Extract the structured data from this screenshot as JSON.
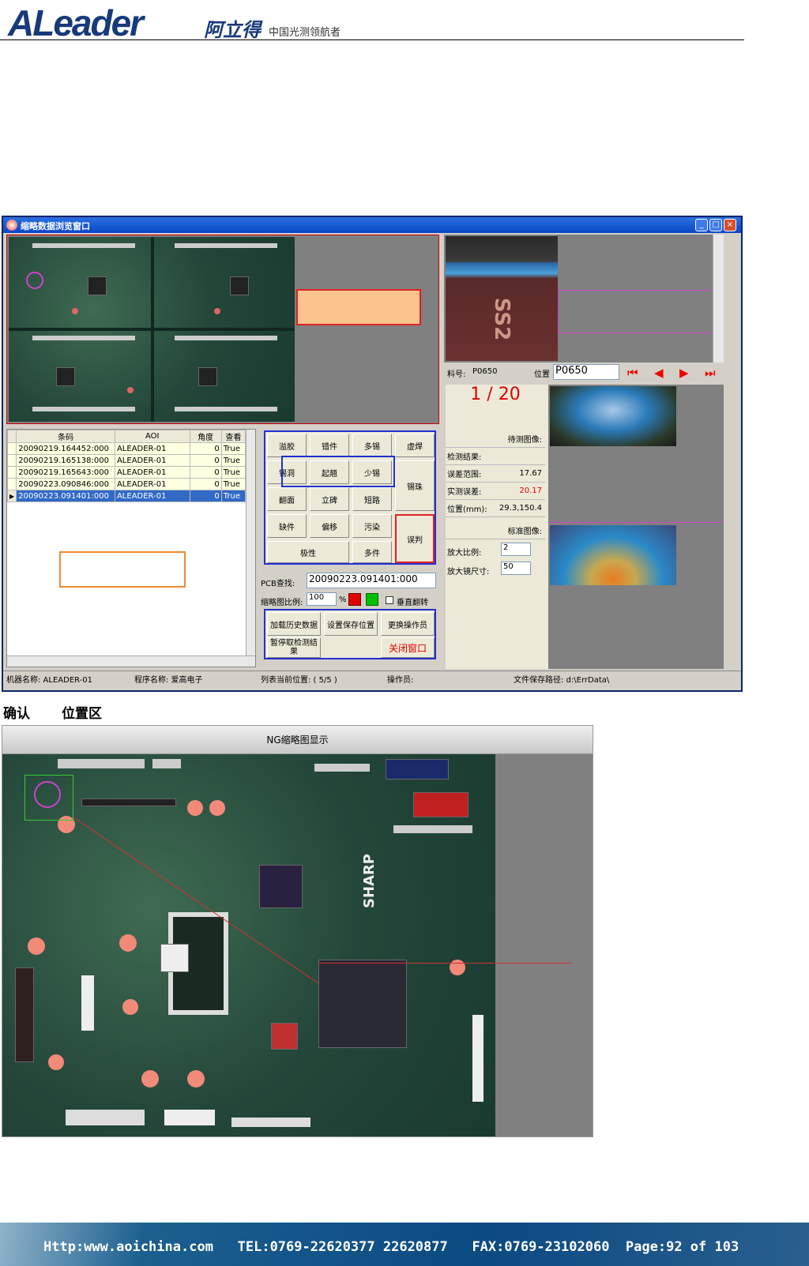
{
  "header": {
    "logo": "ALeader",
    "brand_cn": "阿立得",
    "slogan": "中国光测领航者"
  },
  "window": {
    "title": "缩略数据浏览窗口",
    "controls": [
      "_",
      "□",
      "×"
    ]
  },
  "table": {
    "columns": [
      "条码",
      "AOI",
      "角度",
      "查看"
    ],
    "rows": [
      [
        "20090219.164452:000",
        "ALEADER-01",
        "0",
        "True"
      ],
      [
        "20090219.165138:000",
        "ALEADER-01",
        "0",
        "True"
      ],
      [
        "20090219.165643:000",
        "ALEADER-01",
        "0",
        "True"
      ],
      [
        "20090223.090846:000",
        "ALEADER-01",
        "0",
        "True"
      ],
      [
        "20090223.091401:000",
        "ALEADER-01",
        "0",
        "True"
      ]
    ]
  },
  "defect_buttons": {
    "b1": "溢胶",
    "b2": "错件",
    "b3": "多锡",
    "b4": "虚焊",
    "b5": "锡洞",
    "b6": "起翘",
    "b7": "少锡",
    "b8": "锡珠",
    "b9": "翻面",
    "b10": "立碑",
    "b11": "短路",
    "b12": "缺件",
    "b13": "偏移",
    "b14": "污染",
    "b15": "误判",
    "b16": "极性",
    "b17": "多件"
  },
  "controls": {
    "pcb_label": "PCB查找:",
    "pcb_value": "20090223.091401:000",
    "ratio_label": "缩略图比例:",
    "ratio_value": "100",
    "ratio_unit": "%",
    "flip_label": "垂直翻转",
    "load_history": "加载历史数据",
    "set_save_pos": "设置保存位置",
    "change_operator": "更换操作员",
    "pause_fetch": "暂停取检测结果",
    "close_window": "关闭窗口"
  },
  "part": {
    "part_label": "料号:",
    "part_value": "P0650",
    "pos_label": "位置",
    "pos_value": "P0650",
    "counter": "1 / 20"
  },
  "info": {
    "test_image": "待测图像:",
    "result": "检测结果:",
    "tolerance_label": "误差范围:",
    "tolerance_value": "17.67",
    "measured_label": "实测误差:",
    "measured_value": "20.17",
    "position_label": "位置(mm):",
    "position_value": "29.3,150.4",
    "std_image": "标准图像:",
    "zoom_ratio_label": "放大比例:",
    "zoom_ratio_value": "2",
    "zoom_size_label": "放大镜尺寸:",
    "zoom_size_value": "50"
  },
  "status": {
    "machine": "机器名称: ALEADER-01",
    "program": "程序名称: 爱高电子",
    "list_pos": "列表当前位置: ( 5/5 )",
    "operator": "操作员:",
    "save_path": "文件保存路径: d:\\ErrData\\"
  },
  "section": {
    "confirm": "确认",
    "position_area": "位置区"
  },
  "ng_panel": {
    "title": "NG缩略图显示",
    "board_text": "SHARP"
  },
  "footer": {
    "text": "Http:www.aoichina.com   TEL:0769-22620377 22620877   FAX:0769-23102060  Page:92 of 103"
  },
  "colors": {
    "accent_red": "#e00000",
    "select_blue": "#316ac5",
    "title_blue": "#0a46c8"
  }
}
